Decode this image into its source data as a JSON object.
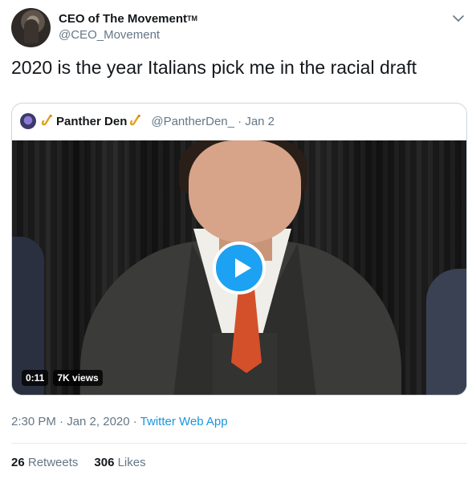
{
  "tweet": {
    "author": {
      "display_name": "CEO of The Movement",
      "trademark": "TM",
      "handle": "@CEO_Movement"
    },
    "text": "2020 is the year Italians pick me in the racial draft",
    "menu_icon": "chevron-down-icon",
    "quoted": {
      "display_name": "Panther Den",
      "emoji": "saxophone-icon",
      "handle": "@PantherDen_",
      "separator": "·",
      "date": "Jan 2",
      "video": {
        "duration": "0:11",
        "views": "7K views"
      }
    },
    "timestamp": "2:30 PM · Jan 2, 2020",
    "separator": "·",
    "source": "Twitter Web App",
    "stats": {
      "retweets_count": "26",
      "retweets_label": "Retweets",
      "likes_count": "306",
      "likes_label": "Likes"
    }
  },
  "colors": {
    "text": "#14171a",
    "secondary": "#657786",
    "link": "#1b95e0",
    "accent": "#1da1f2",
    "border": "#ccd6dd"
  }
}
